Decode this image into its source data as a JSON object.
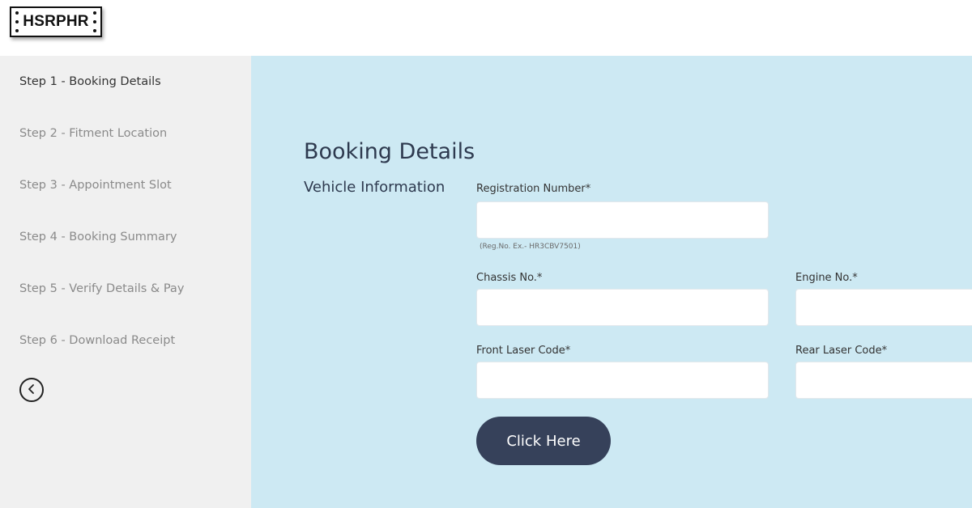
{
  "header": {
    "logo_text": "HSRPHR"
  },
  "sidebar": {
    "steps": [
      {
        "label": "Step 1 - Booking Details"
      },
      {
        "label": "Step 2 - Fitment Location"
      },
      {
        "label": "Step 3 - Appointment Slot"
      },
      {
        "label": "Step 4 - Booking Summary"
      },
      {
        "label": "Step 5 - Verify Details & Pay"
      },
      {
        "label": "Step 6 - Download Receipt"
      }
    ],
    "active_step": 1,
    "back_icon": "chevron-left-circle-icon"
  },
  "main": {
    "title": "Booking Details",
    "section": "Vehicle Information",
    "fields": {
      "registration": {
        "label": "Registration Number*",
        "value": "",
        "hint": "(Reg.No. Ex.- HR3CBV7501)"
      },
      "chassis": {
        "label": "Chassis No.*",
        "value": ""
      },
      "engine": {
        "label": "Engine No.*",
        "value": ""
      },
      "front_laser": {
        "label": "Front Laser Code*",
        "value": ""
      },
      "rear_laser": {
        "label": "Rear Laser Code*",
        "value": ""
      }
    },
    "submit_label": "Click Here"
  },
  "colors": {
    "main_bg": "#cde9f3",
    "sidebar_bg": "#f0f0f0",
    "button_bg": "#36415a",
    "title_text": "#2e3a4f"
  }
}
